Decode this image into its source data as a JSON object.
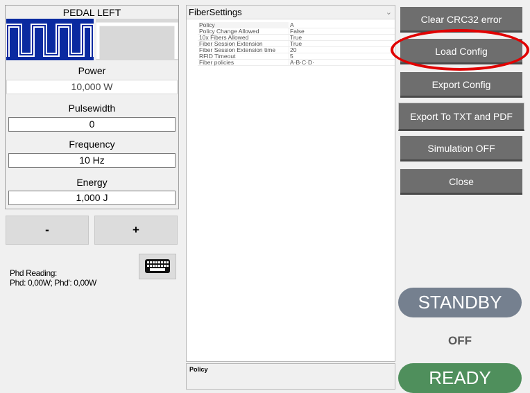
{
  "left_panel": {
    "title": "PEDAL LEFT",
    "pedal_modes": [
      {
        "name": "pulsed-mode",
        "selected": true
      },
      {
        "name": "continuous-mode",
        "selected": false
      }
    ],
    "power": {
      "label": "Power",
      "value": "10,000 W"
    },
    "pulsewidth": {
      "label": "Pulsewidth",
      "value": "0"
    },
    "frequency": {
      "label": "Frequency",
      "value": "10 Hz"
    },
    "energy": {
      "label": "Energy",
      "value": "1,000 J"
    },
    "minus_label": "-",
    "plus_label": "+",
    "keyboard_icon": "keyboard-icon",
    "phd_label": "Phd Reading:",
    "phd_value": "Phd: 0,00W; Phd': 0,00W"
  },
  "property_grid": {
    "title": "FiberSettings",
    "rows": [
      {
        "name": "Policy",
        "value": "A"
      },
      {
        "name": "Policy Change Allowed",
        "value": "False"
      },
      {
        "name": "10x Fibers Allowed",
        "value": "True"
      },
      {
        "name": "Fiber Session Extension",
        "value": "True"
      },
      {
        "name": "Fiber Session Extension time",
        "value": "20"
      },
      {
        "name": "RFID Timeout",
        "value": "5"
      },
      {
        "name": "Fiber policies",
        "value": "A·B·C·D·"
      }
    ],
    "description_title": "Policy"
  },
  "right_panel": {
    "buttons": {
      "clear_crc": "Clear CRC32 error",
      "load_config": "Load Config",
      "export_config": "Export Config",
      "export_txt_pdf": "Export To TXT and PDF",
      "simulation": "Simulation OFF",
      "close": "Close"
    },
    "standby": "STANDBY",
    "off": "OFF",
    "ready": "READY"
  },
  "colors": {
    "pedal_selected": "#0a2aa0",
    "button_gray": "#6e6e6e",
    "standby": "#75808f",
    "ready": "#4f8f5c",
    "highlight_ring": "#e00000"
  }
}
